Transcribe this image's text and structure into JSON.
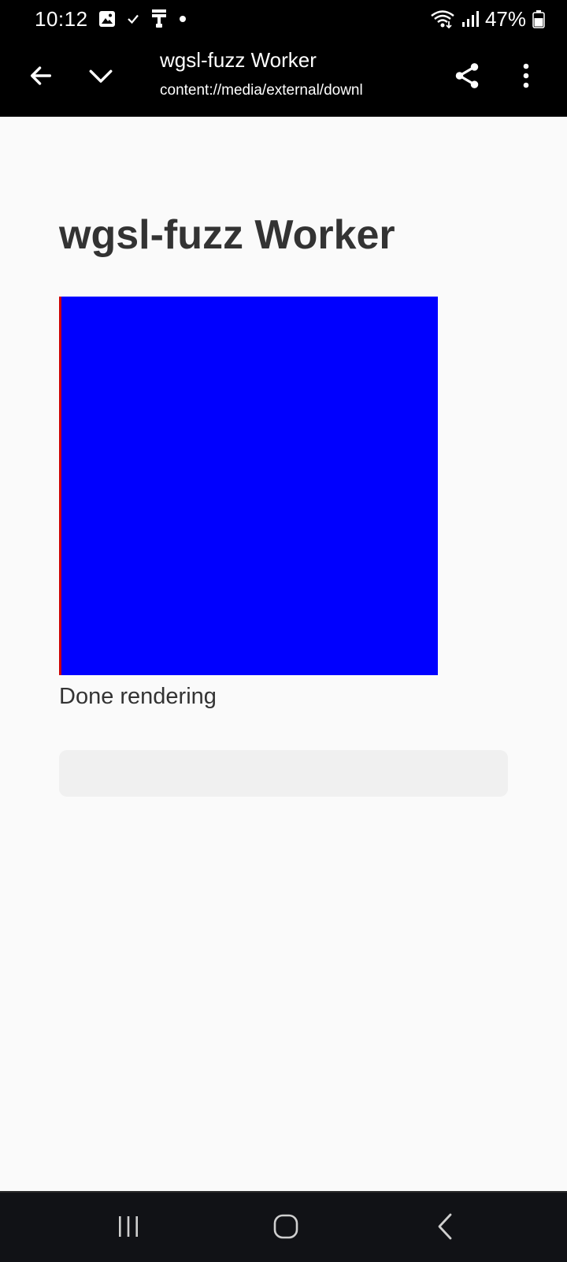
{
  "status_bar": {
    "time": "10:12",
    "battery_percent": "47%",
    "icons": [
      "gallery-icon",
      "check-icon",
      "usb-icon",
      "dot-icon",
      "wifi-icon",
      "signal-icon",
      "battery-icon"
    ]
  },
  "toolbar": {
    "title": "wgsl-fuzz Worker",
    "url": "content://media/external/downl",
    "icons": [
      "back-arrow-icon",
      "chevron-down-icon",
      "share-icon",
      "more-vert-icon"
    ]
  },
  "page": {
    "heading": "wgsl-fuzz Worker",
    "canvas_color": "#0000ff",
    "status_text": "Done rendering"
  },
  "nav_bar": {
    "icons": [
      "recents-icon",
      "home-icon",
      "back-icon"
    ]
  },
  "colors": {
    "status_bar_bg": "#000000",
    "toolbar_bg": "#000000",
    "page_bg": "#fafafa",
    "heading_text": "#333333",
    "canvas_fill": "#0000ff",
    "canvas_edge": "#cc0000",
    "output_box_bg": "#f0f0f0",
    "nav_bar_bg": "#111216"
  }
}
